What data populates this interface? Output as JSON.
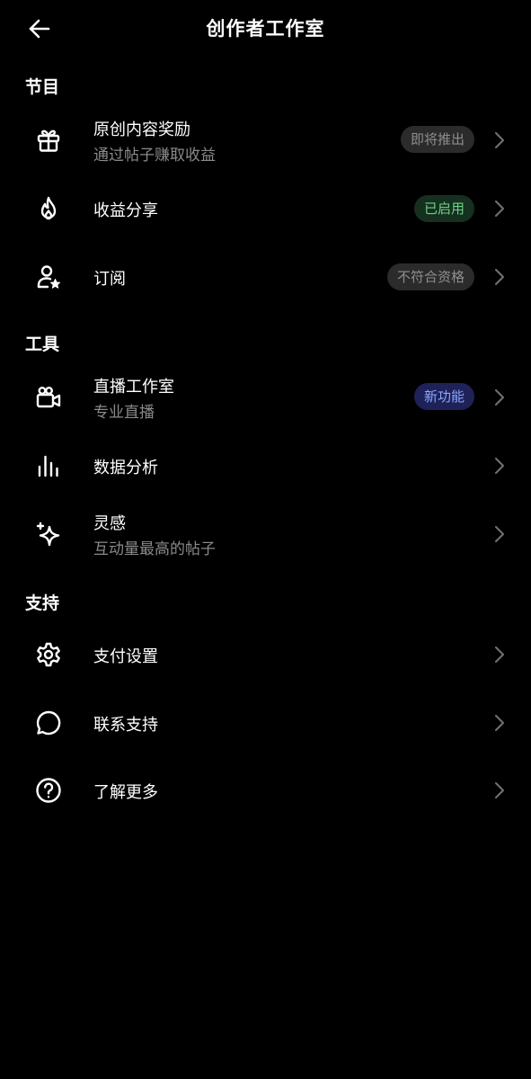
{
  "header": {
    "title": "创作者工作室",
    "back_icon": "arrow-left-icon"
  },
  "sections": {
    "programs": {
      "title": "节目"
    },
    "tools": {
      "title": "工具"
    },
    "support": {
      "title": "支持"
    }
  },
  "items": {
    "original_rewards": {
      "label": "原创内容奖励",
      "sublabel": "通过帖子赚取收益",
      "badge": "即将推出",
      "icon": "gift-icon"
    },
    "revenue_share": {
      "label": "收益分享",
      "badge": "已启用",
      "icon": "flame-icon"
    },
    "subscriptions": {
      "label": "订阅",
      "badge": "不符合资格",
      "icon": "person-star-icon"
    },
    "live_studio": {
      "label": "直播工作室",
      "sublabel": "专业直播",
      "badge": "新功能",
      "icon": "video-camera-icon"
    },
    "analytics": {
      "label": "数据分析",
      "icon": "bar-chart-icon"
    },
    "inspiration": {
      "label": "灵感",
      "sublabel": "互动量最高的帖子",
      "icon": "sparkle-icon"
    },
    "payment_settings": {
      "label": "支付设置",
      "icon": "gear-icon"
    },
    "contact_support": {
      "label": "联系支持",
      "icon": "chat-bubble-icon"
    },
    "learn_more": {
      "label": "了解更多",
      "icon": "question-circle-icon"
    }
  },
  "colors": {
    "background": "#000000",
    "text_primary": "#ffffff",
    "text_secondary": "#8a8a8a",
    "badge_gray_bg": "#2b2b2b",
    "badge_gray_text": "#8e8e8e",
    "badge_green_bg": "#15301f",
    "badge_green_text": "#6fd08a",
    "badge_blue_bg": "#1e2258",
    "badge_blue_text": "#8ca6ff",
    "chevron": "#6e6e6e"
  }
}
